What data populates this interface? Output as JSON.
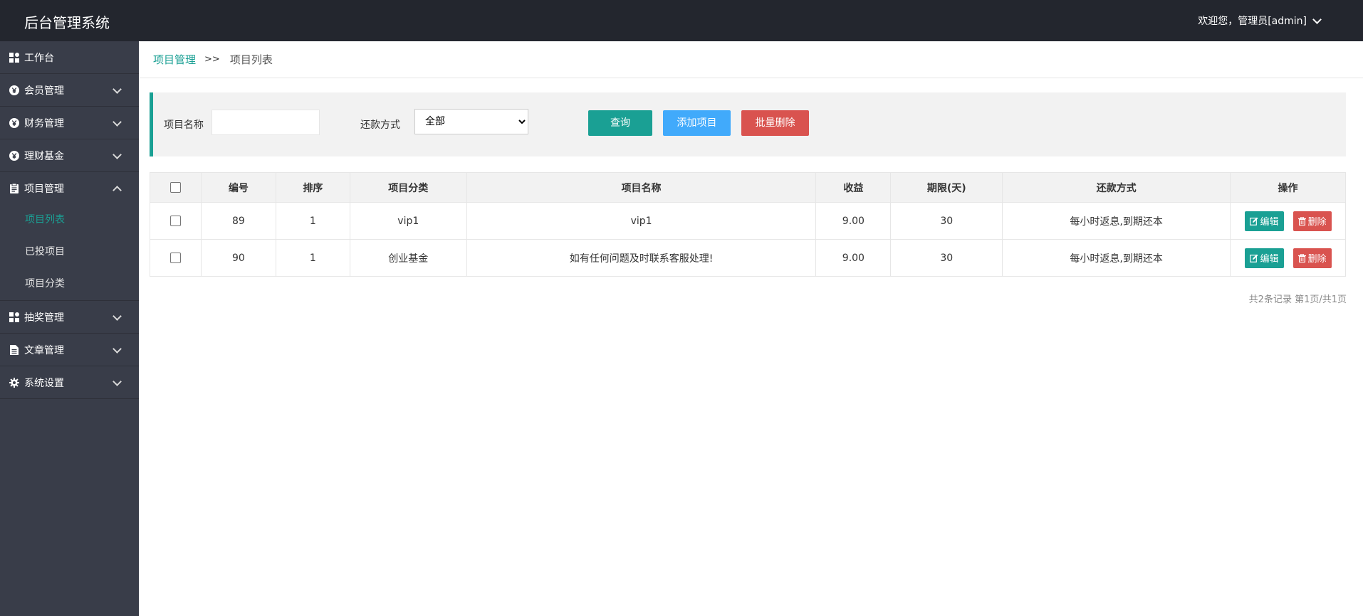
{
  "header": {
    "title": "后台管理系统",
    "user_text": "欢迎您，管理员[admin]"
  },
  "sidebar": {
    "items": [
      {
        "label": "工作台",
        "icon": "dashboard-icon",
        "has_arrow": false
      },
      {
        "label": "会员管理",
        "icon": "yen-icon",
        "has_arrow": true
      },
      {
        "label": "财务管理",
        "icon": "yen-icon",
        "has_arrow": true
      },
      {
        "label": "理财基金",
        "icon": "yen-icon",
        "has_arrow": true
      },
      {
        "label": "项目管理",
        "icon": "clipboard-icon",
        "has_arrow": true,
        "expanded": true
      },
      {
        "label": "抽奖管理",
        "icon": "dashboard-icon",
        "has_arrow": true
      },
      {
        "label": "文章管理",
        "icon": "document-icon",
        "has_arrow": true
      },
      {
        "label": "系统设置",
        "icon": "gear-icon",
        "has_arrow": true
      }
    ],
    "subitems": [
      {
        "label": "项目列表",
        "active": true
      },
      {
        "label": "已投项目",
        "active": false
      },
      {
        "label": "项目分类",
        "active": false
      }
    ]
  },
  "breadcrumb": {
    "parent": "项目管理",
    "separator": ">>",
    "current": "项目列表"
  },
  "search": {
    "name_label": "项目名称",
    "name_value": "",
    "repay_label": "还款方式",
    "repay_value": "全部",
    "query_button": "查询",
    "add_button": "添加项目",
    "batch_delete_button": "批量删除"
  },
  "table": {
    "columns": [
      "编号",
      "排序",
      "项目分类",
      "项目名称",
      "收益",
      "期限(天)",
      "还款方式",
      "操作"
    ],
    "rows": [
      {
        "id": "89",
        "sort": "1",
        "category": "vip1",
        "name": "vip1",
        "yield": "9.00",
        "term": "30",
        "repay": "每小时返息,到期还本"
      },
      {
        "id": "90",
        "sort": "1",
        "category": "创业基金",
        "name": "如有任何问题及时联系客服处理!",
        "yield": "9.00",
        "term": "30",
        "repay": "每小时返息,到期还本"
      }
    ],
    "edit_label": "编辑",
    "delete_label": "删除"
  },
  "pager": {
    "text": "共2条记录 第1页/共1页"
  },
  "colors": {
    "accent": "#1aa094",
    "blue": "#41aafb",
    "red": "#d9534f",
    "topbar": "#23262e",
    "sidebar": "#393d49"
  }
}
